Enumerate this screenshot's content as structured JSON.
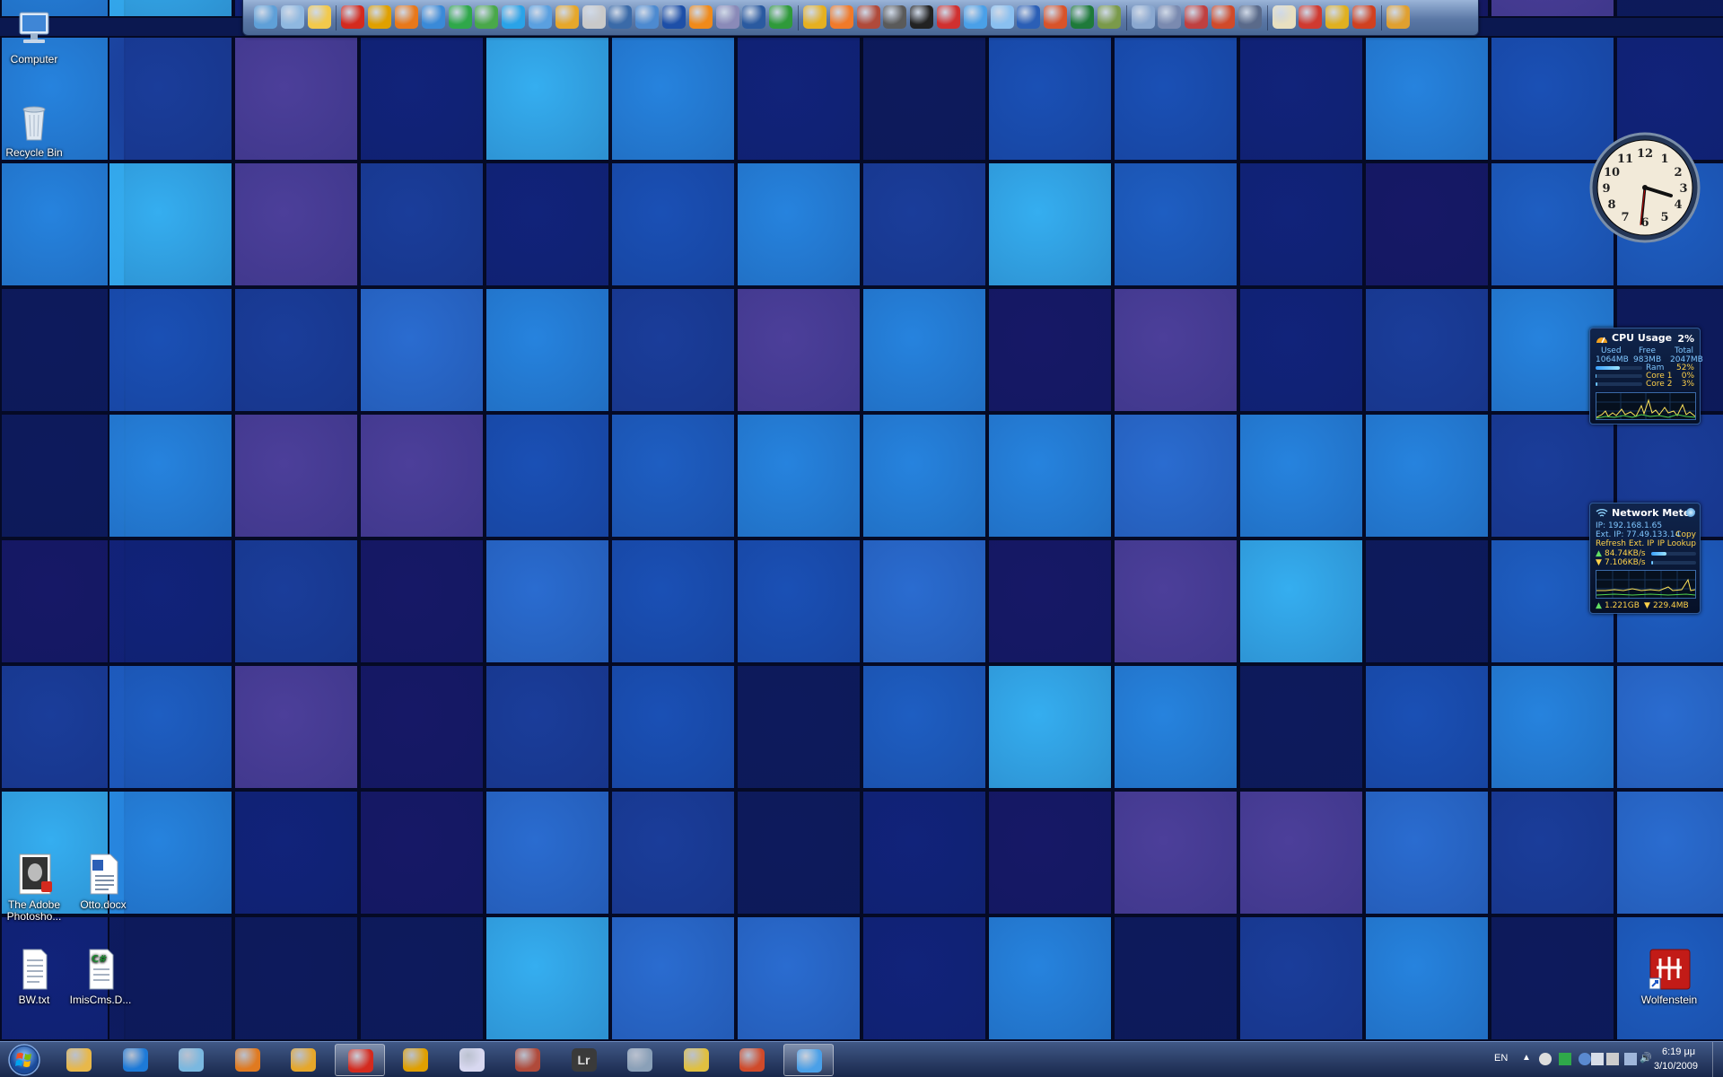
{
  "desktop": {
    "icons": [
      {
        "label": "Computer"
      },
      {
        "label": "Recycle Bin"
      },
      {
        "label": "The Adobe Photosho..."
      },
      {
        "label": "Otto.docx"
      },
      {
        "label": "BW.txt"
      },
      {
        "label": "ImisCms.D..."
      },
      {
        "label": "Wolfenstein"
      }
    ]
  },
  "quick_launch": {
    "icons": [
      "monitor-icon",
      "network-folder-icon",
      "folder-icon",
      "opera-icon",
      "chrome-icon",
      "firefox-icon",
      "safari-icon",
      "utorrent-icon",
      "messenger-icon",
      "skype-icon",
      "gtalk-icon",
      "winamp-icon",
      "search-icon",
      "media-converter-icon",
      "magnifier-tool-icon",
      "monitor-app-icon",
      "vlc-icon",
      "audio-tool-icon",
      "sopcast-icon",
      "tvu-icon",
      "nero-icon",
      "burner-icon",
      "firewall-icon",
      "video-edit-icon",
      "nx2-icon",
      "photo-viewer-icon",
      "picasa-icon",
      "paper-icon",
      "word-icon",
      "powerpoint-icon",
      "excel-icon",
      "library-icon",
      "settings-gear-icon",
      "codec-icon",
      "tools-icon",
      "magnet-icon",
      "scanner-icon",
      "notepad-icon",
      "toolbox-icon",
      "network-tool-icon",
      "pencil-brush-icon",
      "wrench-icon"
    ]
  },
  "cpu_gadget": {
    "title": "CPU Usage",
    "percent": "2%",
    "used_label": "Used",
    "free_label": "Free",
    "total_label": "Total",
    "used": "1064MB",
    "free": "983MB",
    "total": "2047MB",
    "ram_label": "Ram",
    "ram_value": "52%",
    "ram_level": 0.52,
    "core1_label": "Core 1",
    "core1_value": "0%",
    "core1_level": 0.0,
    "core2_label": "Core 2",
    "core2_value": "3%",
    "core2_level": 0.03
  },
  "network_gadget": {
    "title": "Network Meter",
    "ip": "IP: 192.168.1.65",
    "ext_ip": "Ext. IP: 77.49.133.14",
    "copy": "Copy",
    "refresh": "Refresh Ext. IP",
    "lookup": "IP Lookup",
    "upload_speed": "84.74KB/s",
    "download_speed": "7.106KB/s",
    "total_up": "1.221GB",
    "total_down": "229.4MB"
  },
  "taskbar": {
    "apps": [
      {
        "name": "explorer-app"
      },
      {
        "name": "internet-explorer-app"
      },
      {
        "name": "notes-app"
      },
      {
        "name": "media-player-app"
      },
      {
        "name": "winamp-app"
      },
      {
        "name": "opera-app",
        "active": true
      },
      {
        "name": "chrome-app"
      },
      {
        "name": "media-app"
      },
      {
        "name": "archive-app"
      },
      {
        "name": "lightroom-app",
        "label": "Lr"
      },
      {
        "name": "scanner-app"
      },
      {
        "name": "network-tools-app"
      },
      {
        "name": "tools-app"
      },
      {
        "name": "messenger-app",
        "active": true
      }
    ],
    "language": "EN",
    "time": "6:19 μμ",
    "date": "3/10/2009"
  }
}
